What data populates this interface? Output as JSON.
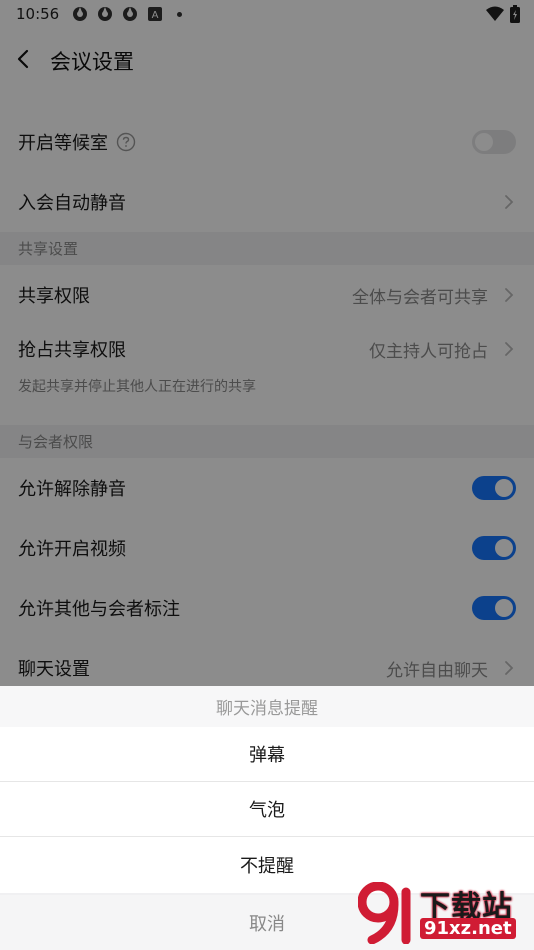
{
  "status_bar": {
    "time": "10:56",
    "badge_a": "A"
  },
  "header": {
    "title": "会议设置"
  },
  "settings": {
    "waiting_room": {
      "label": "开启等候室",
      "enabled": false
    },
    "auto_mute": {
      "label": "入会自动静音"
    },
    "share_section": "共享设置",
    "share_permission": {
      "label": "共享权限",
      "value": "全体与会者可共享"
    },
    "grab_share": {
      "label": "抢占共享权限",
      "value": "仅主持人可抢占"
    },
    "grab_share_note": "发起共享并停止其他人正在进行的共享",
    "participant_section": "与会者权限",
    "allow_unmute": {
      "label": "允许解除静音",
      "enabled": true
    },
    "allow_video": {
      "label": "允许开启视频",
      "enabled": true
    },
    "allow_annotate": {
      "label": "允许其他与会者标注",
      "enabled": true
    },
    "chat_settings": {
      "label": "聊天设置",
      "value": "允许自由聊天"
    }
  },
  "sheet": {
    "title": "聊天消息提醒",
    "options": [
      "弹幕",
      "气泡",
      "不提醒"
    ],
    "cancel": "取消"
  },
  "watermark": {
    "top": "下载站",
    "bottom": "91xz.net"
  },
  "colors": {
    "accent": "#1677ff",
    "toggle_off": "#e3e3e6",
    "watermark": "#d01c34"
  }
}
